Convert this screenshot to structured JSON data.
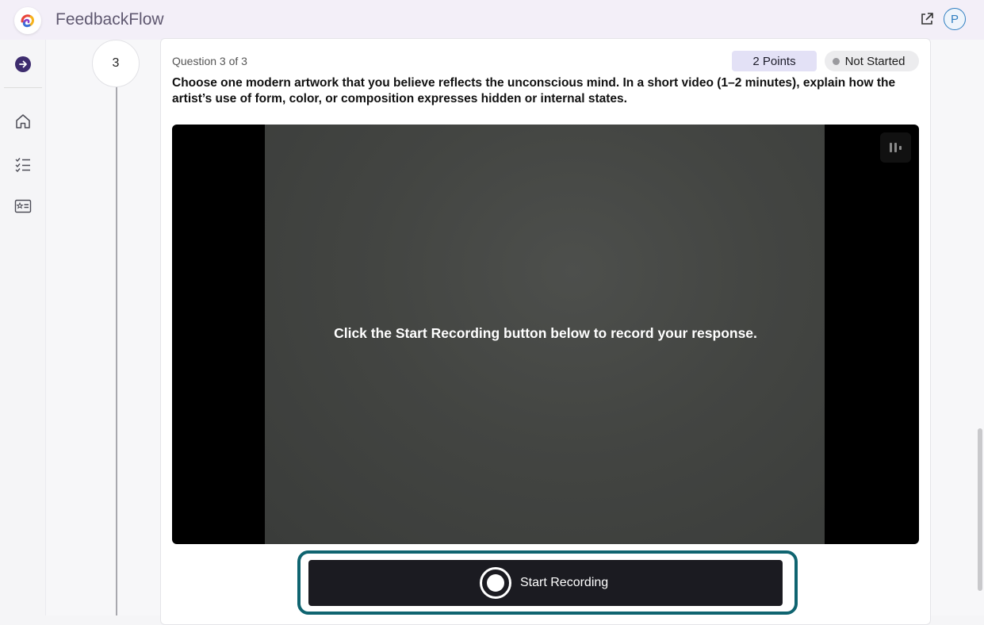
{
  "app": {
    "title": "FeedbackFlow",
    "user_initial": "P"
  },
  "sidebar": {
    "items": [
      {
        "icon": "home-icon"
      },
      {
        "icon": "checklist-icon"
      },
      {
        "icon": "id-card-icon"
      }
    ]
  },
  "step": {
    "number": "3"
  },
  "question": {
    "counter": "Question 3 of 3",
    "points": "2 Points",
    "status": "Not Started",
    "text": "Choose one modern artwork that you believe reflects the unconscious mind. In a short video (1–2 minutes), explain how the artist’s use of form, color, or composition expresses hidden or internal states."
  },
  "video": {
    "message": "Click the Start Recording button below to record your response."
  },
  "record": {
    "label": "Start Recording"
  },
  "colors": {
    "accent": "#0f6470",
    "brand": "#3d2c6e",
    "button_bg": "#1b1b21"
  }
}
